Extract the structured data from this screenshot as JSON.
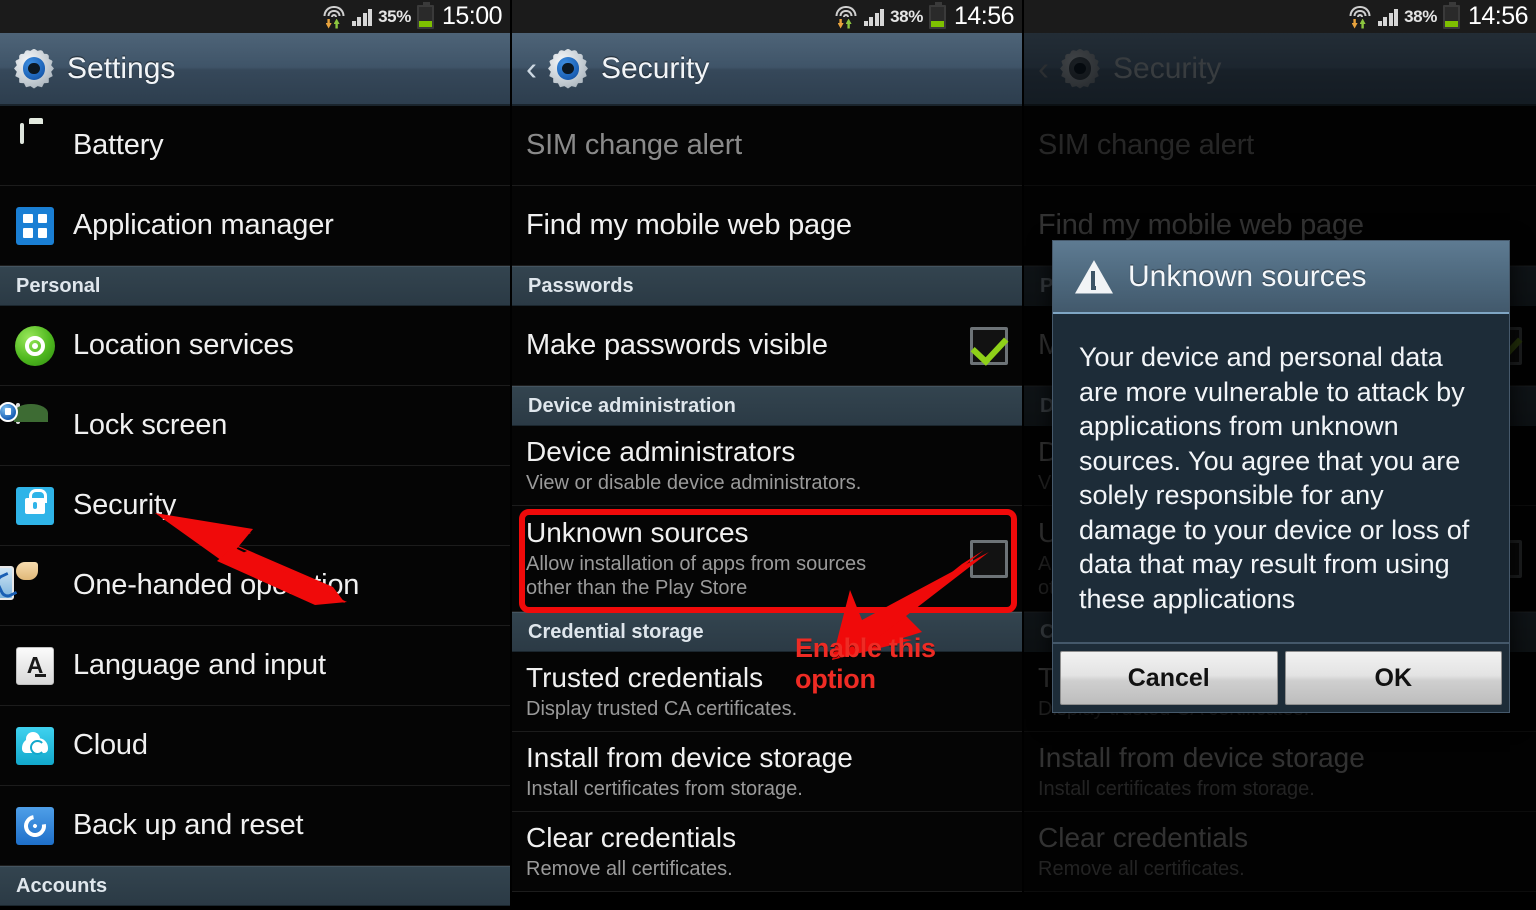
{
  "panels": [
    {
      "id": "settings",
      "statusbar": {
        "battery_pct": "35%",
        "time": "15:00"
      },
      "actionbar": {
        "title": "Settings",
        "has_back": false
      },
      "rows": [
        {
          "type": "item",
          "label": "Battery",
          "icon": "battery-icon"
        },
        {
          "type": "item",
          "label": "Application manager",
          "icon": "application-manager-icon"
        },
        {
          "type": "section",
          "label": "Personal"
        },
        {
          "type": "item",
          "label": "Location services",
          "icon": "location-services-icon"
        },
        {
          "type": "item",
          "label": "Lock screen",
          "icon": "lock-screen-icon"
        },
        {
          "type": "item",
          "label": "Security",
          "icon": "security-lock-icon"
        },
        {
          "type": "item",
          "label": "One-handed operation",
          "icon": "one-handed-operation-icon"
        },
        {
          "type": "item",
          "label": "Language and input",
          "icon": "language-input-icon"
        },
        {
          "type": "item",
          "label": "Cloud",
          "icon": "cloud-icon"
        },
        {
          "type": "item",
          "label": "Back up and reset",
          "icon": "backup-reset-icon"
        },
        {
          "type": "section",
          "label": "Accounts"
        }
      ],
      "annotation": {
        "target": "Security"
      }
    },
    {
      "id": "security",
      "statusbar": {
        "battery_pct": "38%",
        "time": "14:56"
      },
      "actionbar": {
        "title": "Security",
        "has_back": true
      },
      "rows": [
        {
          "type": "item",
          "label": "SIM change alert",
          "disabled": true
        },
        {
          "type": "item",
          "label": "Find my mobile web page"
        },
        {
          "type": "section",
          "label": "Passwords"
        },
        {
          "type": "item",
          "label": "Make passwords visible",
          "checkbox": "checked"
        },
        {
          "type": "section",
          "label": "Device administration"
        },
        {
          "type": "item",
          "label": "Device administrators",
          "sub": "View or disable device administrators."
        },
        {
          "type": "item",
          "label": "Unknown sources",
          "sub": "Allow installation of apps from sources other than the Play Store",
          "checkbox": "unchecked",
          "highlighted": true
        },
        {
          "type": "section",
          "label": "Credential storage"
        },
        {
          "type": "item",
          "label": "Trusted credentials",
          "sub": "Display trusted CA certificates."
        },
        {
          "type": "item",
          "label": "Install from device storage",
          "sub": "Install certificates from storage."
        },
        {
          "type": "item",
          "label": "Clear credentials",
          "sub": "Remove all certificates."
        }
      ],
      "annotation": {
        "label": "Enable this option",
        "color": "#ee2b24"
      }
    },
    {
      "id": "security-dialog",
      "statusbar": {
        "battery_pct": "38%",
        "time": "14:56"
      },
      "actionbar": {
        "title": "Security",
        "has_back": true
      },
      "rows": [
        {
          "type": "item",
          "label": "SIM change alert",
          "disabled": true
        },
        {
          "type": "item",
          "label": "Find my mobile web page"
        },
        {
          "type": "section",
          "label": "Passwords"
        },
        {
          "type": "item",
          "label": "Make passwords visible",
          "checkbox": "checked"
        },
        {
          "type": "section",
          "label": "Device administration"
        },
        {
          "type": "item",
          "label": "Device administrators",
          "sub": "View or disable device administrators."
        },
        {
          "type": "item",
          "label": "Unknown sources",
          "sub": "Allow installation of apps from sources other than the Play Store",
          "checkbox": "unchecked"
        },
        {
          "type": "section",
          "label": "Credential storage"
        },
        {
          "type": "item",
          "label": "Trusted credentials",
          "sub": "Display trusted CA certificates."
        },
        {
          "type": "item",
          "label": "Install from device storage",
          "sub": "Install certificates from storage."
        },
        {
          "type": "item",
          "label": "Clear credentials",
          "sub": "Remove all certificates."
        }
      ],
      "dialog": {
        "title": "Unknown sources",
        "icon": "warning-triangle-icon",
        "body": "Your device and personal data are more vulnerable to attack by applications from unknown sources. You agree that you are solely responsible for any damage to your device or loss of data that may result from using these applications",
        "cancel_label": "Cancel",
        "ok_label": "OK"
      }
    }
  ],
  "colors": {
    "accent_red": "#f00a0a",
    "annotation_red": "#ee2b24",
    "check_green": "#8fd119",
    "header_blue": "#3f5468",
    "dialog_header": "#4d687d"
  }
}
